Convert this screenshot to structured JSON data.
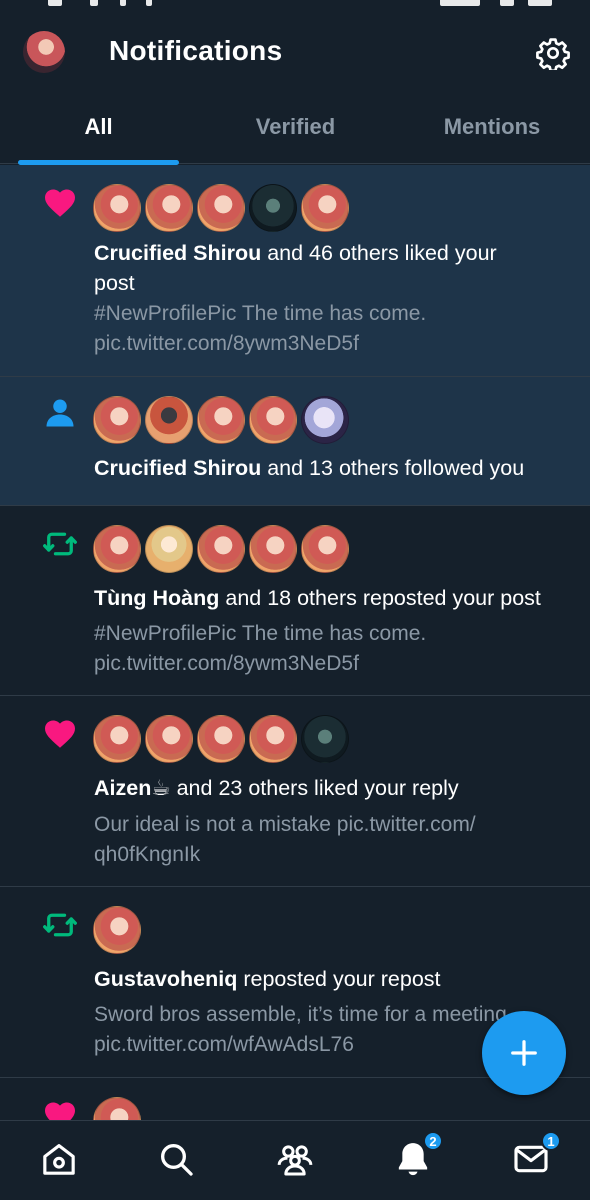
{
  "header": {
    "title": "Notifications"
  },
  "tabs": [
    {
      "label": "All",
      "active": true
    },
    {
      "label": "Verified",
      "active": false
    },
    {
      "label": "Mentions",
      "active": false
    }
  ],
  "notifications": [
    {
      "type": "like",
      "name": "Crucified Shirou",
      "text": " and 46 others liked your",
      "text2": "post",
      "sub1": "#NewProfilePic The time has come.",
      "sub2": "pic.twitter.com/8ywm3NeD5f"
    },
    {
      "type": "follow",
      "name": "Crucified Shirou",
      "text": " and 13 others followed you"
    },
    {
      "type": "repost",
      "name": "Tùng Hoàng",
      "text": " and 18 others reposted your post",
      "sub1": "#NewProfilePic The time has come.",
      "sub2": "pic.twitter.com/8ywm3NeD5f"
    },
    {
      "type": "like",
      "name": "Aizen☕",
      "text": " and 23 others liked your reply",
      "sub1": "Our ideal is not a mistake pic.twitter.com/",
      "sub2": "qh0fKngnIk"
    },
    {
      "type": "repost",
      "name": "Gustavoheniq",
      "text": " reposted your repost",
      "sub1": "Sword bros assemble, it’s time for a meeting",
      "sub2": "pic.twitter.com/wfAwAdsL76"
    }
  ],
  "nav": {
    "notifications_badge": "2",
    "messages_badge": "1"
  },
  "colors": {
    "accent": "#1d9bf0",
    "like": "#f91880",
    "repost": "#00ba7c",
    "bg": "#15202b",
    "unread_bg": "#1e3449"
  }
}
